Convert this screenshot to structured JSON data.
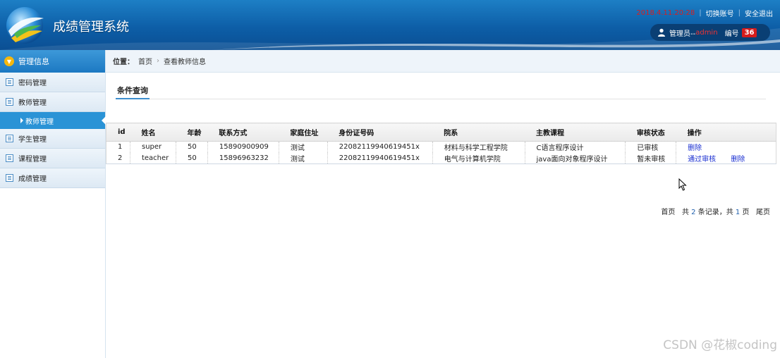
{
  "header": {
    "title": "成绩管理系统",
    "datetime": "2018.4.11.20:28",
    "switch_account": "切换账号",
    "logout": "安全退出",
    "user_prefix": "管理员--",
    "username": "admin",
    "number_label": "编号",
    "number_value": "36",
    "colors": {
      "bg": "#0d5ea7",
      "datetime": "#d81e1e",
      "badge": "#d61c1c"
    }
  },
  "sidebar": {
    "section_title": "管理信息",
    "items": [
      {
        "label": "密码管理",
        "icon": "list-icon"
      },
      {
        "label": "教师管理",
        "icon": "list-icon",
        "expanded": true
      },
      {
        "label": "学生管理",
        "icon": "list-icon"
      },
      {
        "label": "课程管理",
        "icon": "list-icon"
      },
      {
        "label": "成绩管理",
        "icon": "list-icon"
      }
    ],
    "active_sub": "教师管理"
  },
  "breadcrumb": {
    "label": "位置：",
    "home": "首页",
    "current": "查看教师信息"
  },
  "panel": {
    "title": "条件查询"
  },
  "table": {
    "columns": [
      "id",
      "姓名",
      "年龄",
      "联系方式",
      "家庭住址",
      "身份证号码",
      "院系",
      "主教课程",
      "审核状态",
      "操作"
    ],
    "rows": [
      {
        "id": "1",
        "name": "super",
        "age": "50",
        "phone": "15890900909",
        "address": "测试",
        "idcard": "22082119940619451x",
        "dept": "材料与科学工程学院",
        "course": "C语言程序设计",
        "status": "已审核",
        "ops": [
          "删除"
        ]
      },
      {
        "id": "2",
        "name": "teacher",
        "age": "50",
        "phone": "15896963232",
        "address": "测试",
        "idcard": "22082119940619451x",
        "dept": "电气与计算机学院",
        "course": "java面向对象程序设计",
        "status": "暂未审核",
        "ops": [
          "通过审核",
          "删除"
        ]
      }
    ]
  },
  "pager": {
    "first": "首页",
    "total_prefix": "共",
    "total": "2",
    "total_mid": "条记录，共",
    "pages": "1",
    "pages_suffix": "页",
    "last": "尾页"
  },
  "watermark": "CSDN @花椒coding"
}
